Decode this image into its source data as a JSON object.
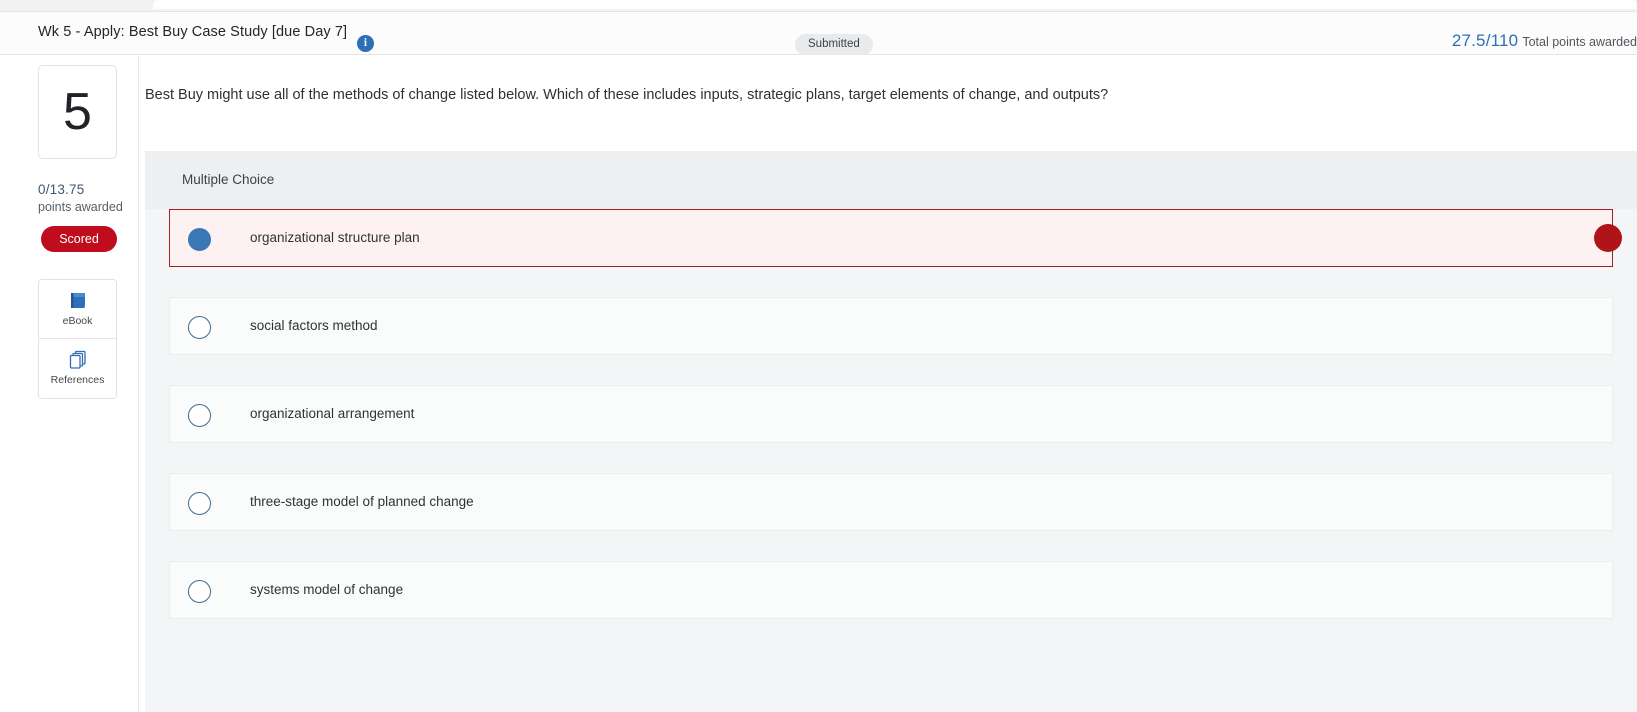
{
  "header": {
    "title": "Wk 5 - Apply: Best Buy Case Study [due Day 7]",
    "info_icon": "info-icon",
    "info_glyph": "i",
    "status_badge": "Submitted",
    "points_value": "27.5/110",
    "points_label": "Total points awarded",
    "points_accent_color": "#2e6fb5"
  },
  "rail": {
    "question_number": "5",
    "points_awarded_value": "0/13.75",
    "points_awarded_label": "points awarded",
    "scored_badge": "Scored",
    "scored_badge_color": "#c00d1e",
    "tools": [
      {
        "label": "eBook",
        "icon": "book-icon"
      },
      {
        "label": "References",
        "icon": "pages-stack-icon"
      }
    ]
  },
  "main": {
    "question_text": "Best Buy might use all of the methods of change listed below. Which of these includes inputs, strategic plans, target elements of change, and outputs?",
    "question_type": "Multiple Choice",
    "selected_option_border_color": "#a32225",
    "selected_option_bg_color": "#fdf2f1",
    "radio_checked_color": "#3a77b5",
    "wrong_marker_color": "#b01419",
    "options": [
      {
        "label": "organizational structure plan",
        "selected": true,
        "marked_wrong": true
      },
      {
        "label": "social factors method",
        "selected": false,
        "marked_wrong": false
      },
      {
        "label": "organizational arrangement",
        "selected": false,
        "marked_wrong": false
      },
      {
        "label": "three-stage model of planned change",
        "selected": false,
        "marked_wrong": false
      },
      {
        "label": "systems model of change",
        "selected": false,
        "marked_wrong": false
      }
    ]
  }
}
